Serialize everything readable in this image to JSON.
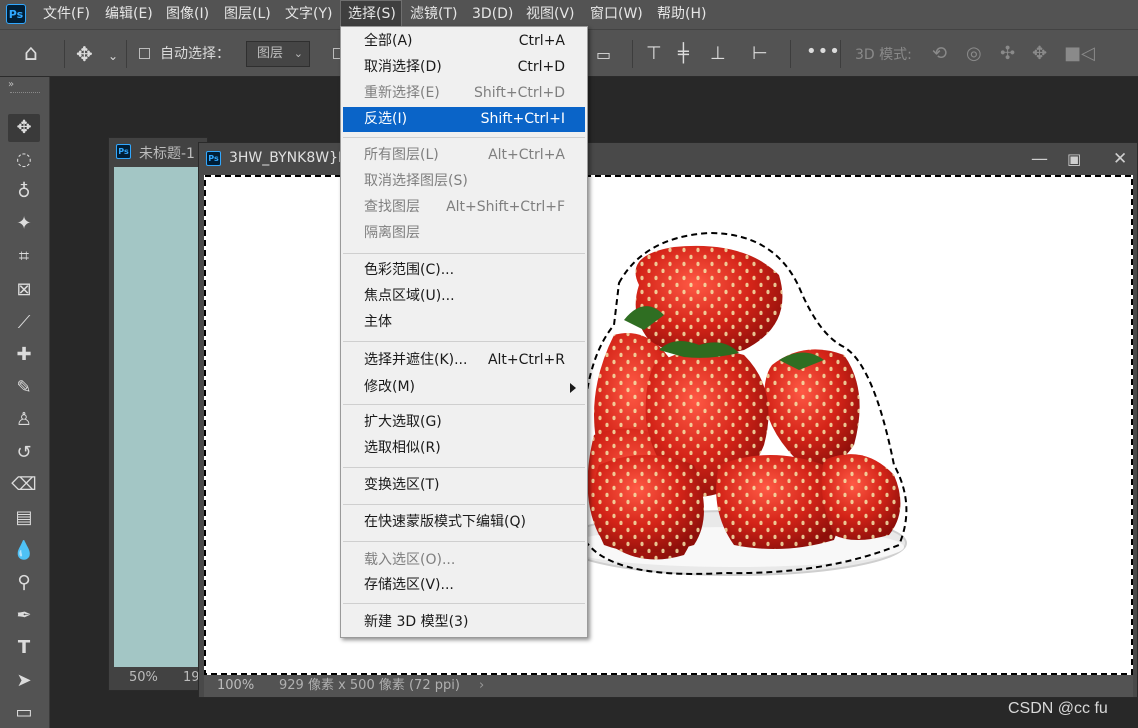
{
  "menubar": {
    "logo": "Ps",
    "items": [
      "文件(F)",
      "编辑(E)",
      "图像(I)",
      "图层(L)",
      "文字(Y)",
      "选择(S)",
      "滤镜(T)",
      "3D(D)",
      "视图(V)",
      "窗口(W)",
      "帮助(H)"
    ]
  },
  "optionsbar": {
    "auto_select_label": "自动选择：",
    "layer_select_value": "图层",
    "mode_3d_label": "3D 模式:"
  },
  "doc_back": {
    "title": "未标题-1",
    "zoom": "50%",
    "partial_status": "19",
    "canvas_color": "#a3c6c5"
  },
  "doc_front": {
    "title": "3HW_BYNK8W}R",
    "zoom": "100%",
    "info": "929 像素 x 500 像素 (72 ppi)"
  },
  "select_menu": {
    "items": [
      {
        "label": "全部(A)",
        "shortcut": "Ctrl+A",
        "state": "normal"
      },
      {
        "label": "取消选择(D)",
        "shortcut": "Ctrl+D",
        "state": "normal"
      },
      {
        "label": "重新选择(E)",
        "shortcut": "Shift+Ctrl+D",
        "state": "disabled"
      },
      {
        "label": "反选(I)",
        "shortcut": "Shift+Ctrl+I",
        "state": "highlighted"
      },
      {
        "label": "所有图层(L)",
        "shortcut": "Alt+Ctrl+A",
        "state": "disabled"
      },
      {
        "label": "取消选择图层(S)",
        "shortcut": "",
        "state": "disabled"
      },
      {
        "label": "查找图层",
        "shortcut": "Alt+Shift+Ctrl+F",
        "state": "disabled"
      },
      {
        "label": "隔离图层",
        "shortcut": "",
        "state": "disabled"
      },
      {
        "label": "色彩范围(C)...",
        "shortcut": "",
        "state": "normal"
      },
      {
        "label": "焦点区域(U)...",
        "shortcut": "",
        "state": "normal"
      },
      {
        "label": "主体",
        "shortcut": "",
        "state": "normal"
      },
      {
        "label": "选择并遮住(K)...",
        "shortcut": "Alt+Ctrl+R",
        "state": "normal"
      },
      {
        "label": "修改(M)",
        "shortcut": "",
        "state": "normal"
      },
      {
        "label": "扩大选取(G)",
        "shortcut": "",
        "state": "normal"
      },
      {
        "label": "选取相似(R)",
        "shortcut": "",
        "state": "normal"
      },
      {
        "label": "变换选区(T)",
        "shortcut": "",
        "state": "normal"
      },
      {
        "label": "在快速蒙版模式下编辑(Q)",
        "shortcut": "",
        "state": "normal"
      },
      {
        "label": "载入选区(O)...",
        "shortcut": "",
        "state": "disabled"
      },
      {
        "label": "存储选区(V)...",
        "shortcut": "",
        "state": "normal"
      },
      {
        "label": "新建 3D 模型(3)",
        "shortcut": "",
        "state": "normal"
      }
    ]
  },
  "watermark": "CSDN @cc fu",
  "colors": {
    "accent": "#31a8ff",
    "highlight": "#0a64c8",
    "strawberry": "#d22a1e"
  }
}
